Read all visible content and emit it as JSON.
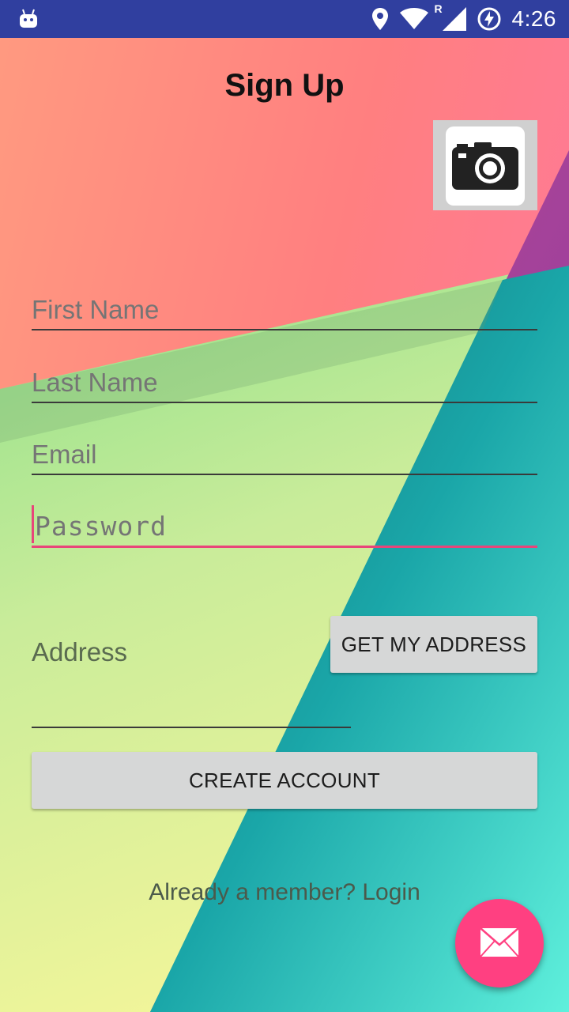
{
  "status_bar": {
    "time": "4:26",
    "network_label": "R",
    "icons": [
      "android-debug-icon",
      "location-icon",
      "wifi-icon",
      "signal-icon",
      "battery-charging-icon"
    ]
  },
  "page": {
    "title": "Sign Up"
  },
  "form": {
    "first_name_placeholder": "First Name",
    "last_name_placeholder": "Last Name",
    "email_placeholder": "Email",
    "password_placeholder": "Password",
    "address_label": "Address",
    "get_address_label": "GET MY ADDRESS",
    "create_account_label": "CREATE ACCOUNT",
    "login_link": "Already a member? Login"
  },
  "colors": {
    "status_bar": "#303f9f",
    "accent": "#ff4081",
    "button": "#d6d7d7"
  }
}
